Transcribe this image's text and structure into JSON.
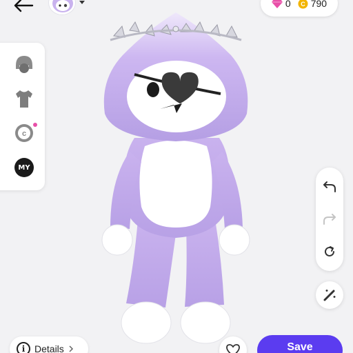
{
  "header": {
    "gems_count": "0",
    "coins_count": "790"
  },
  "bottom": {
    "details_label": "Details",
    "save_label": "Save"
  },
  "left_panel": {
    "items": [
      {
        "icon": "hair-icon"
      },
      {
        "icon": "shirt-icon"
      },
      {
        "icon": "creator-coin-icon"
      },
      {
        "icon": "my-badge",
        "label": "MY"
      }
    ]
  },
  "right_panel": {
    "items": [
      {
        "icon": "undo-icon"
      },
      {
        "icon": "redo-icon"
      },
      {
        "icon": "reset-icon"
      }
    ]
  },
  "colors": {
    "accent": "#5b3cf0",
    "gem": "#e84fa8",
    "coin": "#f2b400",
    "costume": "#c8b3f0"
  }
}
